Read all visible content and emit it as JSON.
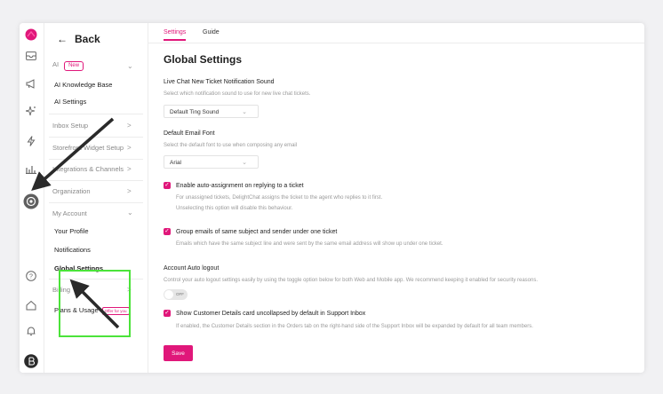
{
  "sidebar": {
    "back_label": "Back",
    "sections": [
      {
        "label": "AI",
        "badge": "New",
        "chevron": "⌄"
      },
      {
        "label": "Inbox Setup",
        "chevron": ">"
      },
      {
        "label": "Storefront Widget Setup",
        "chevron": ">"
      },
      {
        "label": "Integrations & Channels",
        "chevron": ">"
      },
      {
        "label": "Organization",
        "chevron": ">"
      },
      {
        "label": "My Account",
        "chevron": "⌄"
      },
      {
        "label": "Billing",
        "chevron": ">"
      }
    ],
    "ai_items": [
      "AI Knowledge Base",
      "AI Settings"
    ],
    "account_items": [
      "Your Profile",
      "Notifications",
      "Global Settings"
    ],
    "billing_items": [
      {
        "label": "Plans & Usage",
        "badge": "Offer for you"
      }
    ]
  },
  "tabs": [
    "Settings",
    "Guide"
  ],
  "page": {
    "title": "Global Settings",
    "sound_label": "Live Chat New Ticket Notification Sound",
    "sound_desc": "Select which notification sound to use for new live chat tickets.",
    "sound_value": "Default Ting Sound",
    "font_label": "Default Email Font",
    "font_desc": "Select the default font to use when composing any email",
    "font_value": "Arial",
    "auto_assign_label": "Enable auto-assignment on replying to a ticket",
    "auto_assign_desc1": "For unassigned tickets, DelightChat assigns the ticket to the agent who replies to it first.",
    "auto_assign_desc2": "Unselecting this option will disable this behaviour.",
    "group_label": "Group emails of same subject and sender under one ticket",
    "group_desc": "Emails which have the same subject line and were sent by the same email address will show up under one ticket.",
    "logout_label": "Account Auto logout",
    "logout_desc": "Control your auto logout settings easily by using the toggle option below for both Web and Mobile app. We recommend keeping it enabled for security reasons.",
    "toggle_text": "OFF",
    "customer_label": "Show Customer Details card uncollapsed by default in Support Inbox",
    "customer_desc": "If enabled, the Customer Details section in the Orders tab on the right-hand side of the Support Inbox will be expanded by default for all team members.",
    "save_label": "Save",
    "checkmark": "✓"
  },
  "colors": {
    "accent": "#e0177a",
    "highlight": "#4be33a"
  },
  "icons": [
    "logo-icon",
    "inbox-icon",
    "megaphone-icon",
    "sparkle-icon",
    "lightning-icon",
    "chart-icon",
    "settings-icon",
    "help-icon",
    "home-icon",
    "bell-icon",
    "avatar-icon"
  ]
}
